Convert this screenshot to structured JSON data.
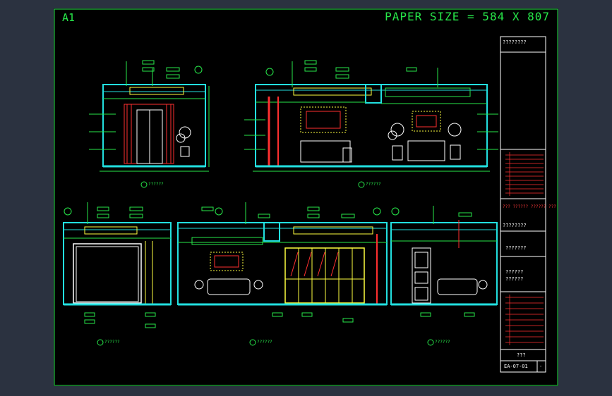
{
  "sheet": {
    "label": "A1",
    "paper_size": "PAPER SIZE = 584 X 807"
  },
  "elevations": [
    {
      "id": "elev-top-left",
      "title": "??????"
    },
    {
      "id": "elev-top-right",
      "title": "??????"
    },
    {
      "id": "elev-bottom-left",
      "title": "??????"
    },
    {
      "id": "elev-bottom-middle",
      "title": "??????"
    },
    {
      "id": "elev-bottom-right",
      "title": "??????"
    }
  ],
  "title_block": {
    "header": "????????",
    "company": "??? ?????? ?????? ???",
    "project_note": "????????",
    "drawing_name_1": "???????",
    "drawing_name_2": "??????",
    "drawing_name_3": "??????",
    "scale": "???",
    "number": "EA-07-01",
    "sheet_index": "-"
  },
  "colors": {
    "frame": "#27e84a",
    "wall": "#22e0e0",
    "ceiling": "#ffff40",
    "text": "#27e84a",
    "accent": "#ff3030",
    "furniture": "#ffffff"
  }
}
